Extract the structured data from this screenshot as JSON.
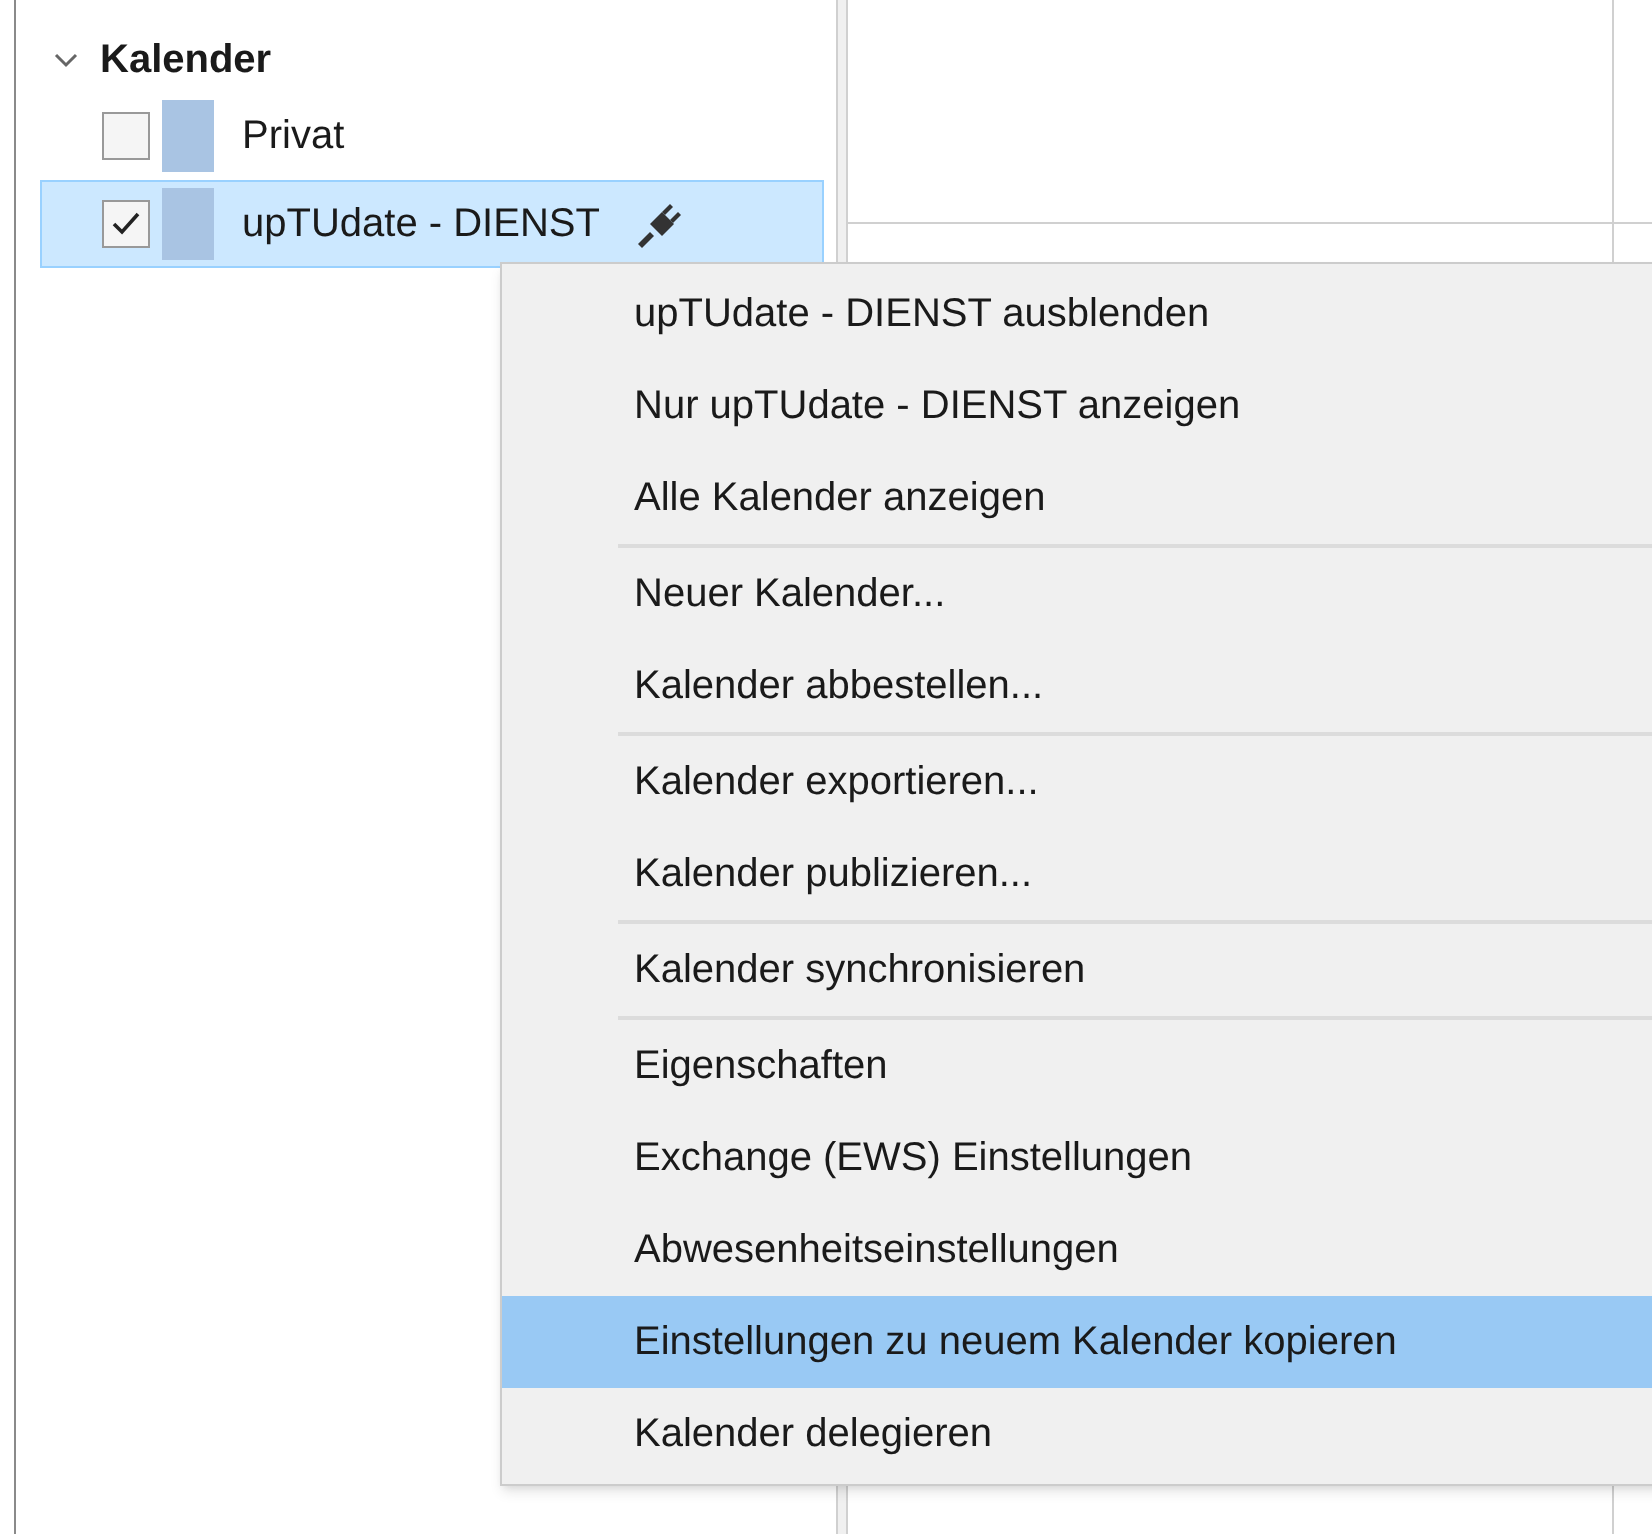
{
  "sidebar": {
    "section": {
      "title": "Kalender",
      "expanded": true
    },
    "calendars": [
      {
        "name": "Privat",
        "checked": false,
        "selected": false,
        "color": "#a9c4e3",
        "connected": false
      },
      {
        "name": "upTUdate - DIENST",
        "checked": true,
        "selected": true,
        "color": "#a9c4e3",
        "connected": true
      }
    ]
  },
  "context_menu": {
    "groups": [
      [
        {
          "label": "upTUdate - DIENST ausblenden",
          "selected": false
        },
        {
          "label": "Nur upTUdate - DIENST anzeigen",
          "selected": false
        },
        {
          "label": "Alle Kalender anzeigen",
          "selected": false
        }
      ],
      [
        {
          "label": "Neuer Kalender...",
          "selected": false
        },
        {
          "label": "Kalender abbestellen...",
          "selected": false
        }
      ],
      [
        {
          "label": "Kalender exportieren...",
          "selected": false
        },
        {
          "label": "Kalender publizieren...",
          "selected": false
        }
      ],
      [
        {
          "label": "Kalender synchronisieren",
          "selected": false
        }
      ],
      [
        {
          "label": "Eigenschaften",
          "selected": false
        },
        {
          "label": "Exchange (EWS) Einstellungen",
          "selected": false
        },
        {
          "label": "Abwesenheitseinstellungen",
          "selected": false
        },
        {
          "label": "Einstellungen zu neuem Kalender kopieren",
          "selected": true
        },
        {
          "label": "Kalender delegieren",
          "selected": false
        }
      ]
    ]
  }
}
